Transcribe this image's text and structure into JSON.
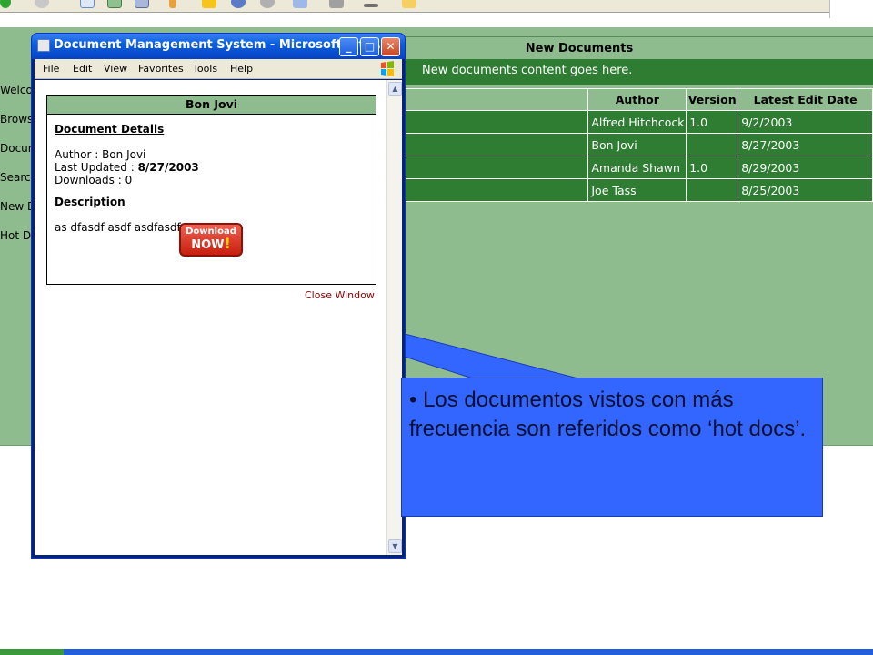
{
  "browser_toolbar": {
    "icons": [
      "back-icon",
      "help-icon",
      "page-icon",
      "picture-icon",
      "3d-icon",
      "edit-icon",
      "favorites-star-icon",
      "media-icon",
      "history-icon",
      "mail-icon",
      "print-icon",
      "minimize-icon",
      "folder-icon"
    ]
  },
  "nav": {
    "items": [
      "Welco",
      "Brows",
      "Docum",
      "Search",
      "New D",
      "Hot Do"
    ]
  },
  "new_documents": {
    "title": "New Documents",
    "content": "New documents content goes here.",
    "columns": [
      "",
      "Author",
      "Version",
      "Latest Edit Date"
    ],
    "rows": [
      {
        "title": "",
        "author": "Alfred Hitchcock",
        "version": "1.0",
        "date": "9/2/2003"
      },
      {
        "title": "",
        "author": "Bon Jovi",
        "version": "",
        "date": "8/27/2003"
      },
      {
        "title": "",
        "author": "Amanda Shawn",
        "version": "1.0",
        "date": "8/29/2003"
      },
      {
        "title": "",
        "author": "Joe Tass",
        "version": "",
        "date": "8/25/2003"
      }
    ]
  },
  "popup": {
    "title": "Document Management System - Microsoft Inter...",
    "buttons": {
      "minimize": "_",
      "maximize": "□",
      "close": "✕"
    },
    "menu": [
      "File",
      "Edit",
      "View",
      "Favorites",
      "Tools",
      "Help"
    ],
    "box_title": "Bon Jovi",
    "details_heading": "Document Details",
    "author_line": "Author : Bon Jovi",
    "last_updated_label": "Last Updated : ",
    "last_updated_value": "8/27/2003",
    "downloads_line": "Downloads : 0",
    "description_heading": "Description",
    "description_text": "as dfasdf asdf asdfasdf",
    "download_top": "Download",
    "download_bottom": "NOW",
    "download_bang": "!",
    "close_link": "Close Window"
  },
  "callout": {
    "text": "• Los documentos vistos con más frecuencia son referidos como ‘hot docs’.",
    "fill": "#3366ff"
  },
  "colors": {
    "page_green": "#8fbc8f",
    "dark_green": "#2e7d32",
    "xp_blue": "#0a5fe0"
  }
}
